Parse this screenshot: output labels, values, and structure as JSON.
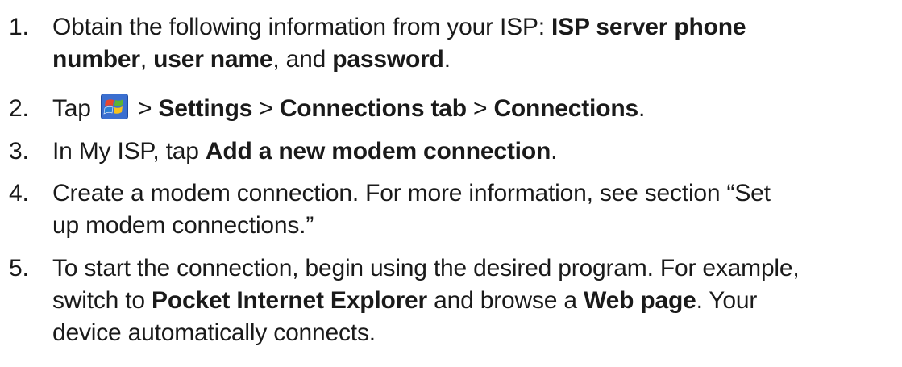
{
  "steps": [
    {
      "number": "1.",
      "line1_a": "Obtain the following information from your ISP:  ",
      "line1_b": "ISP server phone",
      "line2_a": "number",
      "line2_b": ", ",
      "line2_c": "user name",
      "line2_d": ", and ",
      "line2_e": "password",
      "line2_f": "."
    },
    {
      "number": "2.",
      "a": "Tap ",
      "icon": "windows-start-icon",
      "b": " > ",
      "c": "Settings",
      "d": " > ",
      "e": "Connections tab",
      "f": " > ",
      "g": "Connections",
      "h": "."
    },
    {
      "number": "3.",
      "a": "In My ISP, tap ",
      "b": "Add a new modem connection",
      "c": "."
    },
    {
      "number": "4.",
      "line1": "Create a modem connection. For more information, see section “Set",
      "line2": "up modem connections.”"
    },
    {
      "number": "5.",
      "line1": "To start the connection, begin using the desired program. For example,",
      "line2_a": "switch to ",
      "line2_b": "Pocket Internet Explorer",
      "line2_c": " and browse a ",
      "line2_d": "Web page",
      "line2_e": ". Your",
      "line3": "device automatically connects."
    }
  ],
  "colors": {
    "text": "#1a1a1a",
    "flag_red": "#e8452c",
    "flag_green": "#5cb531",
    "flag_blue": "#2a7fd4",
    "flag_yellow": "#f7c21b"
  }
}
